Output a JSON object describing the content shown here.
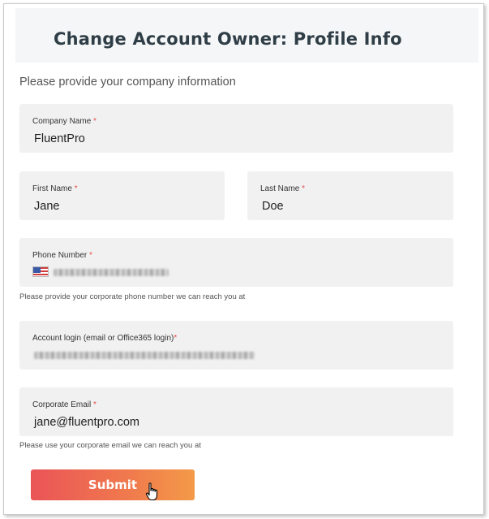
{
  "header": {
    "title": "Change Account Owner: Profile Info"
  },
  "intro_text": "Please provide your company information",
  "required_marker": "*",
  "fields": {
    "company_name": {
      "label": "Company Name",
      "value": "FluentPro"
    },
    "first_name": {
      "label": "First Name",
      "value": "Jane"
    },
    "last_name": {
      "label": "Last Name",
      "value": "Doe"
    },
    "phone_number": {
      "label": "Phone Number",
      "value_state": "redacted",
      "country_flag": "us-flag-icon"
    },
    "account_login": {
      "label": "Account login (email or Office365 login)",
      "value_state": "redacted"
    },
    "corporate_email": {
      "label": "Corporate Email",
      "value": "jane@fluentpro.com"
    }
  },
  "hints": {
    "phone": "Please provide your corporate phone number we can reach you at",
    "email": "Please use your corporate email we can reach you at"
  },
  "submit": {
    "label": "Submit"
  },
  "colors": {
    "button_gradient_start": "#ea5457",
    "button_gradient_end": "#f39a48",
    "required": "#e44d4d",
    "field_background": "#f1f1f1",
    "header_background": "#f5f6f7"
  }
}
